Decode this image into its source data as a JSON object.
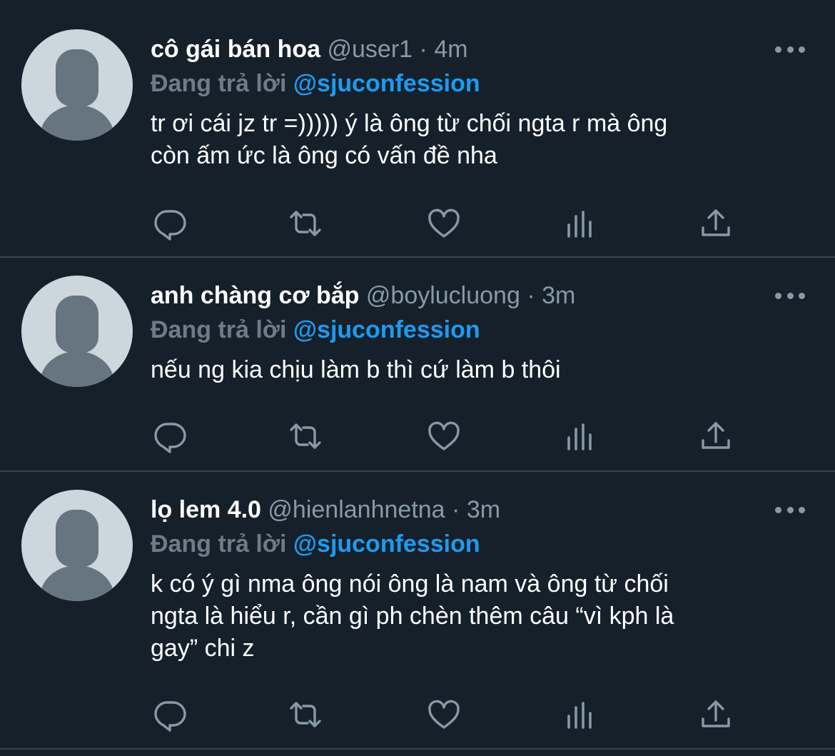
{
  "colors": {
    "background": "#15202b",
    "divider": "#38444d",
    "muted": "#8899a6",
    "accent": "#1d9bf0",
    "text": "#ffffff"
  },
  "tweets": [
    {
      "display_name": "cô gái bán hoa",
      "handle": "@user1",
      "separator": "·",
      "time": "4m",
      "reply_prefix": "Đang trả lời",
      "reply_target": "@sjuconfession",
      "text": "tr ơi cái jz tr =))))) ý là ông từ chối ngta r mà ông\ncòn ấm ức là ông có vấn đề nha"
    },
    {
      "display_name": "anh chàng cơ bắp",
      "handle": "@boylucluong",
      "separator": "·",
      "time": "3m",
      "reply_prefix": "Đang trả lời",
      "reply_target": "@sjuconfession",
      "text": "nếu ng kia chịu làm b thì cứ làm b thôi"
    },
    {
      "display_name": "lọ lem 4.0",
      "handle": "@hienlanhnetna",
      "separator": "·",
      "time": "3m",
      "reply_prefix": "Đang trả lời",
      "reply_target": "@sjuconfession",
      "text": "k có ý gì nma ông nói ông là nam và ông từ chối\nngta là hiểu r, cần gì ph chèn thêm câu “vì kph là\ngay” chi z"
    }
  ],
  "icons": {
    "reply": "comment-icon",
    "retweet": "retweet-icon",
    "like": "heart-icon",
    "stats": "analytics-icon",
    "share": "share-icon",
    "more": "more-dots-icon",
    "avatar": "default-avatar-icon"
  }
}
